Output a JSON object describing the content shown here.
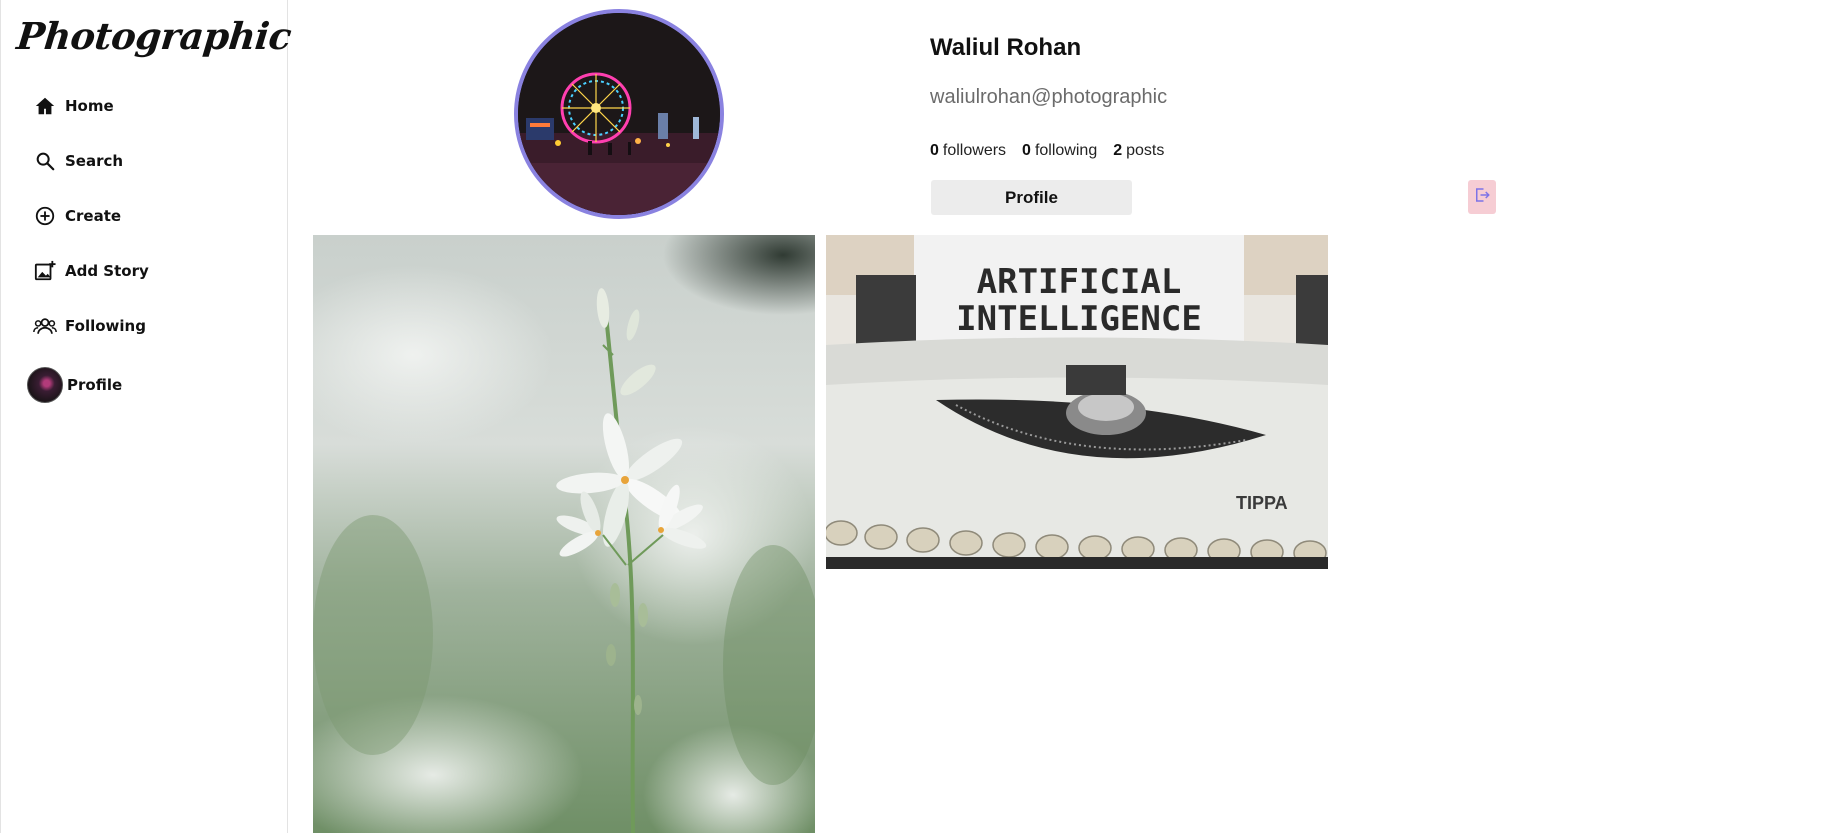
{
  "app": {
    "logo_text": "Photographic"
  },
  "sidebar": {
    "items": [
      {
        "label": "Home",
        "icon": "home-icon"
      },
      {
        "label": "Search",
        "icon": "search-icon"
      },
      {
        "label": "Create",
        "icon": "plus-circle-icon"
      },
      {
        "label": "Add Story",
        "icon": "add-image-icon"
      },
      {
        "label": "Following",
        "icon": "people-icon"
      },
      {
        "label": "Profile",
        "icon": "avatar"
      }
    ]
  },
  "profile": {
    "name": "Waliul Rohan",
    "handle": "waliulrohan@photographic",
    "followers_count": "0",
    "followers_label": "followers",
    "following_count": "0",
    "following_label": "following",
    "posts_count": "2",
    "posts_label": "posts",
    "profile_button_label": "Profile",
    "logout_icon": "logout-icon",
    "avatar_ring_color": "#8a82e0"
  },
  "posts": [
    {
      "kind": "photo",
      "subject": "white lily flower"
    },
    {
      "kind": "photo",
      "subject": "typewriter",
      "paper_text_line1": "ARTIFICIAL",
      "paper_text_line2": "INTELLIGENCE",
      "brand_text": "TIPPA"
    }
  ]
}
